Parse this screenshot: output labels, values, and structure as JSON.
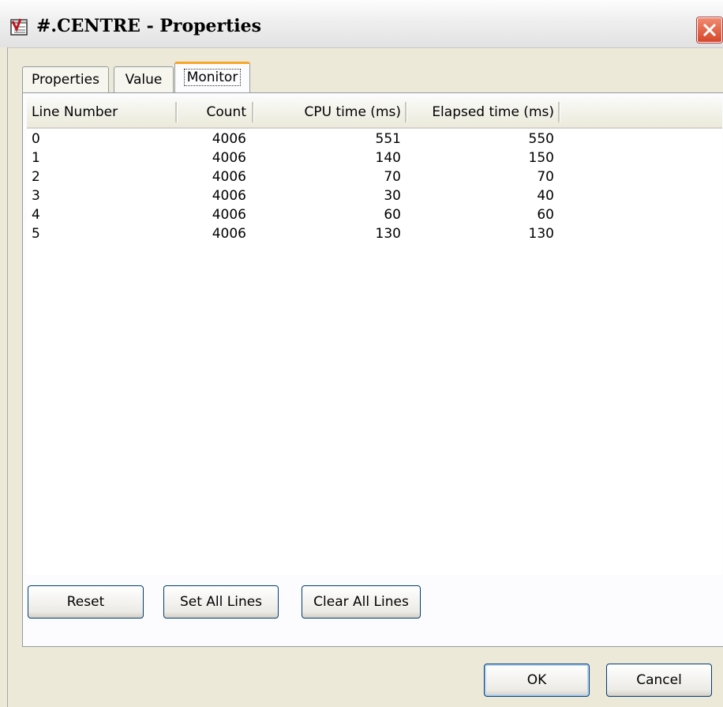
{
  "window": {
    "title": "#.CENTRE - Properties"
  },
  "tabs": [
    {
      "label": "Properties"
    },
    {
      "label": "Value"
    },
    {
      "label": "Monitor"
    }
  ],
  "table": {
    "columns": [
      "Line Number",
      "Count",
      "CPU time (ms)",
      "Elapsed time (ms)"
    ],
    "rows": [
      [
        "0",
        "4006",
        "551",
        "550"
      ],
      [
        "1",
        "4006",
        "140",
        "150"
      ],
      [
        "2",
        "4006",
        "70",
        "70"
      ],
      [
        "3",
        "4006",
        "30",
        "40"
      ],
      [
        "4",
        "4006",
        "60",
        "60"
      ],
      [
        "5",
        "4006",
        "130",
        "130"
      ]
    ]
  },
  "panel_buttons": {
    "reset": "Reset",
    "set_all": "Set All Lines",
    "clear_all": "Clear All Lines"
  },
  "dialog_buttons": {
    "ok": "OK",
    "cancel": "Cancel"
  },
  "icons": {
    "title": "script-properties-icon",
    "close": "close-icon"
  },
  "colors": {
    "dialog_bg": "#ece9d8",
    "active_tab_accent": "#f5a62b",
    "close_button": "#d5472a"
  }
}
